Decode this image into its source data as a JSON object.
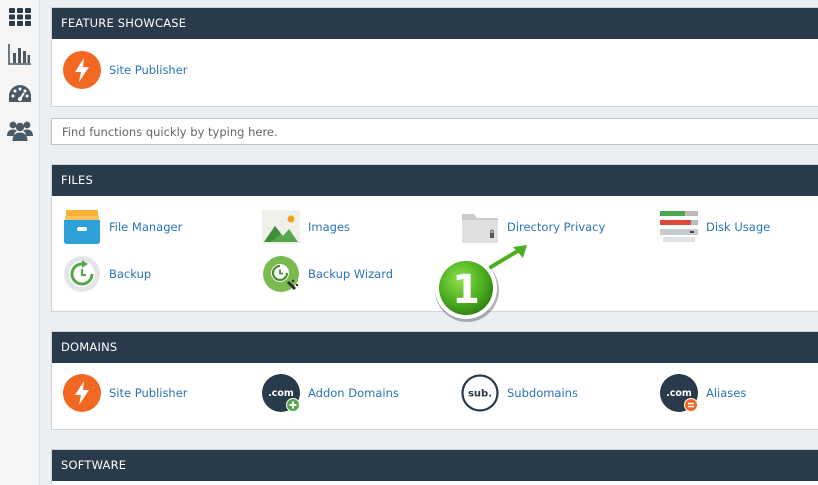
{
  "sidebar": {
    "items": [
      {
        "icon": "grid-icon"
      },
      {
        "icon": "bar-chart-icon"
      },
      {
        "icon": "dashboard-icon"
      },
      {
        "icon": "users-icon"
      }
    ]
  },
  "feature_showcase": {
    "title": "FEATURE SHOWCASE",
    "items": [
      {
        "label": "Site Publisher",
        "icon": "lightning-icon"
      }
    ]
  },
  "search": {
    "placeholder": "Find functions quickly by typing here."
  },
  "files": {
    "title": "FILES",
    "items": [
      {
        "label": "File Manager",
        "icon": "file-manager-icon"
      },
      {
        "label": "Images",
        "icon": "images-icon"
      },
      {
        "label": "Directory Privacy",
        "icon": "directory-privacy-icon"
      },
      {
        "label": "Disk Usage",
        "icon": "disk-usage-icon"
      },
      {
        "label": "Backup",
        "icon": "backup-icon"
      },
      {
        "label": "Backup Wizard",
        "icon": "backup-wizard-icon"
      }
    ]
  },
  "domains": {
    "title": "DOMAINS",
    "items": [
      {
        "label": "Site Publisher",
        "icon": "lightning-icon"
      },
      {
        "label": "Addon Domains",
        "icon": "addon-domains-icon",
        "badge_text": ".com"
      },
      {
        "label": "Subdomains",
        "icon": "subdomains-icon",
        "badge_text": "sub."
      },
      {
        "label": "Aliases",
        "icon": "aliases-icon",
        "badge_text": ".com"
      }
    ]
  },
  "software": {
    "title": "SOFTWARE"
  },
  "callout": {
    "number": "1",
    "color": "#4caf1f"
  },
  "colors": {
    "header": "#293a4a",
    "link": "#2b73b7",
    "accent_orange": "#f26722"
  }
}
